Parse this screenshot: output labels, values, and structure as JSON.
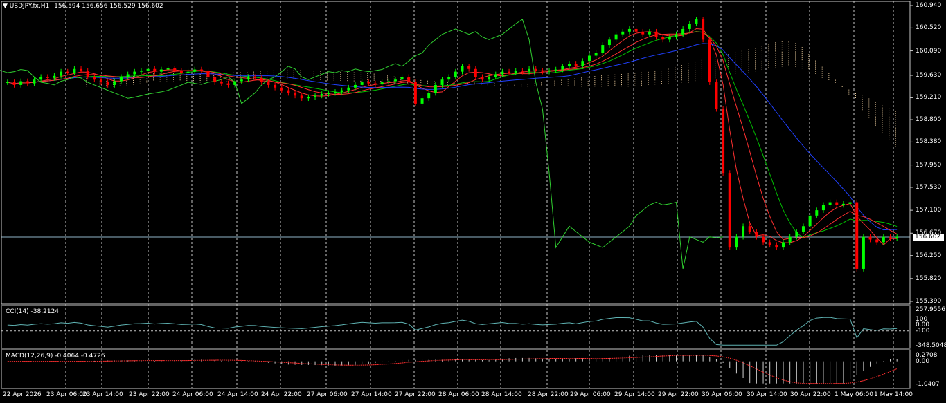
{
  "header": {
    "menu_icon": "triangle-down-icon",
    "symbol": "USDJPY.fx,H1",
    "ohlc": "156.594 156.656 156.529 156.602"
  },
  "price_scale": [
    "160.940",
    "160.520",
    "160.090",
    "159.630",
    "159.210",
    "158.800",
    "158.380",
    "157.950",
    "157.530",
    "157.100",
    "156.670",
    "156.250",
    "155.820",
    "155.390"
  ],
  "current_price": "156.602",
  "cci": {
    "label": "CCI(14) -38.2124",
    "scale": [
      "257.9556",
      "100",
      "0.00",
      "-100",
      "-348.5048"
    ]
  },
  "macd": {
    "label": "MACD(12,26,9) -0.4064 -0.4726",
    "scale": [
      "0.2708",
      "0.00",
      "-1.0407"
    ]
  },
  "time_axis": [
    "22 Apr 2026",
    "23 Apr 06:00",
    "23 Apr 14:00",
    "23 Apr 22:00",
    "24 Apr 06:00",
    "24 Apr 14:00",
    "24 Apr 22:00",
    "27 Apr 06:00",
    "27 Apr 14:00",
    "27 Apr 22:00",
    "28 Apr 06:00",
    "28 Apr 14:00",
    "28 Apr 22:00",
    "29 Apr 06:00",
    "29 Apr 14:00",
    "29 Apr 22:00",
    "30 Apr 06:00",
    "30 Apr 14:00",
    "30 Apr 22:00",
    "1 May 06:00",
    "1 May 14:00"
  ],
  "colors": {
    "background": "#000000",
    "bull": "#00ff00",
    "bear": "#ff0000",
    "grid": "#c8c8c8",
    "cci_line": "#5fb3b3",
    "macd_signal": "#ff3030"
  },
  "chart_data": {
    "type": "candlestick",
    "ylim": [
      155.39,
      160.94
    ],
    "closes": [
      159.5,
      159.45,
      159.52,
      159.48,
      159.55,
      159.6,
      159.58,
      159.62,
      159.7,
      159.68,
      159.75,
      159.72,
      159.6,
      159.55,
      159.5,
      159.45,
      159.52,
      159.6,
      159.65,
      159.7,
      159.72,
      159.75,
      159.7,
      159.74,
      159.76,
      159.72,
      159.68,
      159.7,
      159.74,
      159.72,
      159.6,
      159.5,
      159.48,
      159.45,
      159.52,
      159.55,
      159.6,
      159.58,
      159.5,
      159.45,
      159.4,
      159.35,
      159.3,
      159.25,
      159.2,
      159.22,
      159.25,
      159.28,
      159.3,
      159.32,
      159.35,
      159.4,
      159.45,
      159.5,
      159.48,
      159.46,
      159.5,
      159.52,
      159.55,
      159.6,
      159.5,
      159.1,
      159.2,
      159.3,
      159.45,
      159.55,
      159.6,
      159.7,
      159.8,
      159.75,
      159.6,
      159.55,
      159.6,
      159.65,
      159.7,
      159.68,
      159.72,
      159.7,
      159.75,
      159.72,
      159.7,
      159.72,
      159.74,
      159.8,
      159.85,
      159.8,
      159.9,
      160.0,
      160.05,
      160.2,
      160.3,
      160.4,
      160.45,
      160.5,
      160.45,
      160.4,
      160.45,
      160.35,
      160.3,
      160.35,
      160.4,
      160.5,
      160.6,
      160.68,
      160.3,
      159.5,
      159.0,
      157.8,
      156.4,
      156.6,
      156.8,
      156.7,
      156.6,
      156.5,
      156.45,
      156.4,
      156.5,
      156.6,
      156.7,
      156.8,
      157.0,
      157.1,
      157.2,
      157.25,
      157.2,
      157.22,
      157.25,
      156.0,
      156.6,
      156.55,
      156.5,
      156.6,
      156.58,
      156.6
    ]
  }
}
